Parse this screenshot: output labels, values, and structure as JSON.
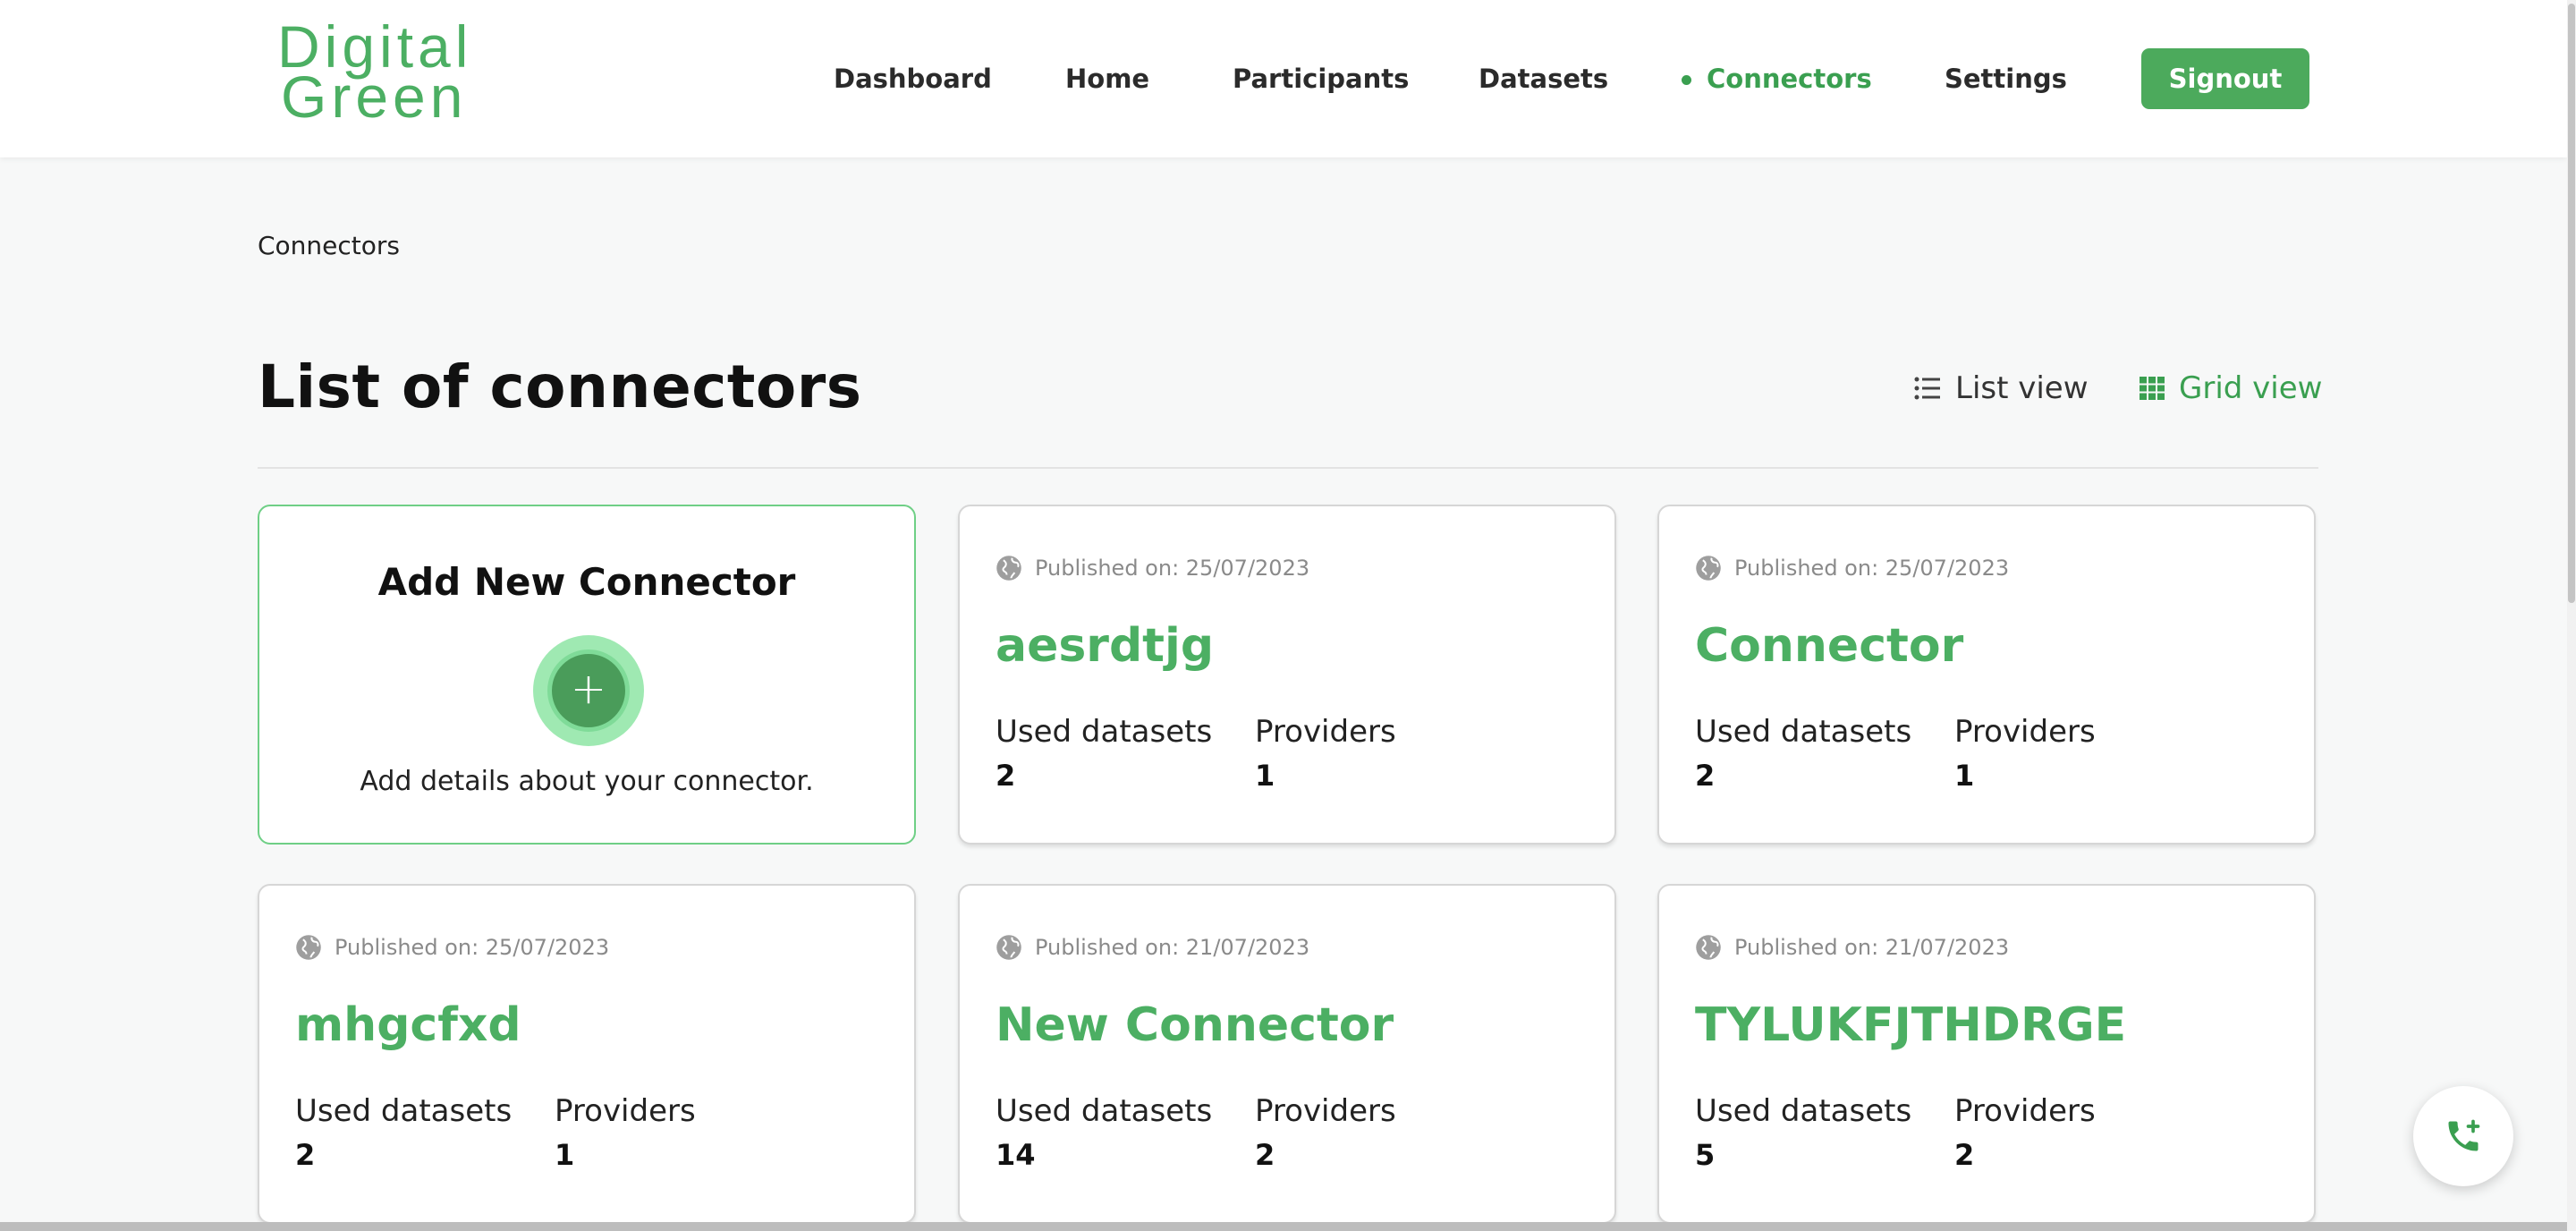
{
  "brand": {
    "line1": "Digital",
    "line2": "Green",
    "accent_color": "#4caf63"
  },
  "nav": {
    "items": [
      {
        "label": "Dashboard",
        "active": false
      },
      {
        "label": "Home",
        "active": false
      },
      {
        "label": "Participants",
        "active": false
      },
      {
        "label": "Datasets",
        "active": false
      },
      {
        "label": "Connectors",
        "active": true
      },
      {
        "label": "Settings",
        "active": false
      }
    ],
    "signout_label": "Signout"
  },
  "breadcrumb": "Connectors",
  "page_title": "List of connectors",
  "view_toggle": {
    "list_label": "List view",
    "grid_label": "Grid view",
    "selected": "Grid view"
  },
  "add_card": {
    "title": "Add New Connector",
    "description": "Add details about your connector."
  },
  "stat_labels": {
    "datasets": "Used datasets",
    "providers": "Providers"
  },
  "connectors": [
    {
      "published": "Published on: 25/07/2023",
      "name": "aesrdtjg",
      "used_datasets": "2",
      "providers": "1"
    },
    {
      "published": "Published on: 25/07/2023",
      "name": "Connector",
      "used_datasets": "2",
      "providers": "1"
    },
    {
      "published": "Published on: 25/07/2023",
      "name": "mhgcfxd",
      "used_datasets": "2",
      "providers": "1"
    },
    {
      "published": "Published on: 21/07/2023",
      "name": "New Connector",
      "used_datasets": "14",
      "providers": "2"
    },
    {
      "published": "Published on: 21/07/2023",
      "name": "TYLUKFJTHDRGE",
      "used_datasets": "5",
      "providers": "2"
    }
  ],
  "icons": {
    "globe": "globe-icon",
    "list": "list-icon",
    "grid": "grid-icon",
    "plus": "plus-icon",
    "call": "phone-add-icon"
  }
}
